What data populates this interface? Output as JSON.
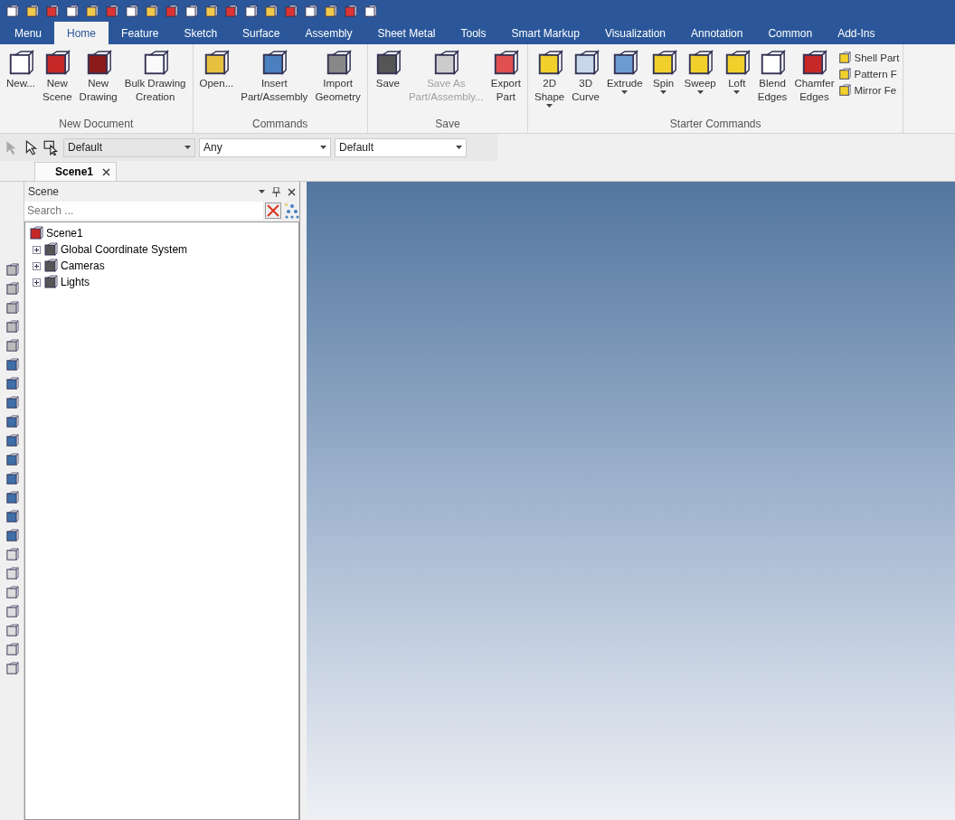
{
  "ribbon_tabs": [
    {
      "label": "Menu",
      "selected": false
    },
    {
      "label": "Home",
      "selected": true
    },
    {
      "label": "Feature",
      "selected": false
    },
    {
      "label": "Sketch",
      "selected": false
    },
    {
      "label": "Surface",
      "selected": false
    },
    {
      "label": "Assembly",
      "selected": false
    },
    {
      "label": "Sheet Metal",
      "selected": false
    },
    {
      "label": "Tools",
      "selected": false
    },
    {
      "label": "Smart Markup",
      "selected": false
    },
    {
      "label": "Visualization",
      "selected": false
    },
    {
      "label": "Annotation",
      "selected": false
    },
    {
      "label": "Common",
      "selected": false
    },
    {
      "label": "Add-Ins",
      "selected": false
    }
  ],
  "ribbon_groups": [
    {
      "title": "New Document",
      "buttons": [
        {
          "label": "New...",
          "disabled": false,
          "dropdown": false
        },
        {
          "label": "New\nScene",
          "disabled": false,
          "dropdown": false
        },
        {
          "label": "New\nDrawing",
          "disabled": false,
          "dropdown": false
        },
        {
          "label": "Bulk Drawing\nCreation",
          "disabled": false,
          "dropdown": false
        }
      ]
    },
    {
      "title": "Commands",
      "buttons": [
        {
          "label": "Open...",
          "disabled": false,
          "dropdown": false
        },
        {
          "label": "Insert\nPart/Assembly",
          "disabled": false,
          "dropdown": false
        },
        {
          "label": "Import\nGeometry",
          "disabled": false,
          "dropdown": false
        }
      ]
    },
    {
      "title": "Save",
      "buttons": [
        {
          "label": "Save",
          "disabled": false,
          "dropdown": false
        },
        {
          "label": "Save As\nPart/Assembly...",
          "disabled": true,
          "dropdown": false
        },
        {
          "label": "Export\nPart",
          "disabled": false,
          "dropdown": false
        }
      ]
    },
    {
      "title": "Starter Commands",
      "buttons": [
        {
          "label": "2D\nShape",
          "disabled": false,
          "dropdown": true
        },
        {
          "label": "3D\nCurve",
          "disabled": false,
          "dropdown": false
        },
        {
          "label": "Extrude",
          "disabled": false,
          "dropdown": true
        },
        {
          "label": "Spin",
          "disabled": false,
          "dropdown": true
        },
        {
          "label": "Sweep",
          "disabled": false,
          "dropdown": true
        },
        {
          "label": "Loft",
          "disabled": false,
          "dropdown": true
        },
        {
          "label": "Blend\nEdges",
          "disabled": false,
          "dropdown": false
        },
        {
          "label": "Chamfer\nEdges",
          "disabled": false,
          "dropdown": false
        }
      ],
      "small_buttons": [
        "Shell Part",
        "Pattern F",
        "Mirror Fe"
      ]
    }
  ],
  "selection_toolbar": {
    "combos": [
      {
        "value": "Default",
        "disabled": true
      },
      {
        "value": "Any",
        "disabled": false
      },
      {
        "value": "Default",
        "disabled": false
      }
    ]
  },
  "document_tabs": [
    {
      "label": "Scene1",
      "selected": true
    }
  ],
  "scene_panel": {
    "title": "Scene",
    "search": {
      "placeholder": "Search ..."
    },
    "tree": [
      {
        "label": "Scene1",
        "children": [
          {
            "label": "Global Coordinate System",
            "expanded": false
          },
          {
            "label": "Cameras",
            "expanded": false
          },
          {
            "label": "Lights",
            "expanded": false
          }
        ]
      }
    ]
  }
}
